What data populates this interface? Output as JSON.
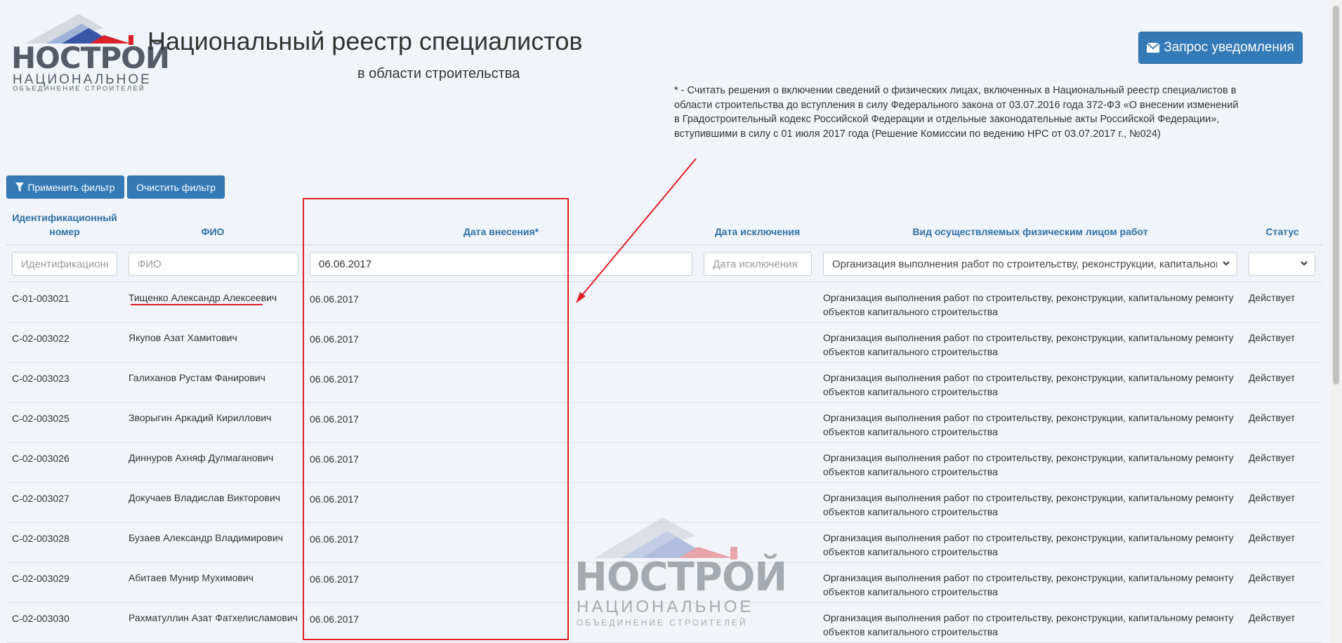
{
  "logo": {
    "word": "НОСТРОЙ",
    "line1": "НАЦИОНАЛЬНОЕ",
    "line2": "ОБЪЕДИНЕНИЕ СТРОИТЕЛЕЙ"
  },
  "header": {
    "title": "Национальный реестр специалистов",
    "subtitle": "в области строительства",
    "notify_button": "Запрос уведомления",
    "notice": "* - Считать решения о включении сведений о физических лицах, включенных в Национальный реестр специалистов в области строительства до вступления в силу Федерального закона от 03.07.2016 года 372-ФЗ «О внесении изменений в Градостроительный кодекс Российской Федерации и отдельные законодательные акты Российской Федерации», вступившими в силу с 01 июля 2017 года (Решение Комиссии по ведению НРС от 03.07.2017 г., №024)"
  },
  "toolbar": {
    "apply_label": "Применить фильтр",
    "clear_label": "Очистить фильтр"
  },
  "table": {
    "headers": {
      "id_line1": "Идентификационный",
      "id_line2": "номер",
      "name": "ФИО",
      "date_added": "Дата внесения*",
      "date_excluded": "Дата исключения",
      "work_type": "Вид осуществляемых физическим лицом работ",
      "status": "Статус"
    },
    "filters": {
      "id_placeholder": "Идентификационный номер",
      "name_placeholder": "ФИО",
      "date_added_value": "06.06.2017",
      "date_excluded_placeholder": "Дата исключения",
      "work_type_selected": "Организация выполнения работ по строительству, реконструкции, капитальному ремонту объектов капитального строительства",
      "status_selected": ""
    },
    "rows": [
      {
        "id": "С-01-003021",
        "name": "Тищенко Александр Алексеевич",
        "date": "06.06.2017",
        "work": "Организация выполнения работ по строительству, реконструкции, капитальному ремонту объектов капитального строительства",
        "status": "Действует"
      },
      {
        "id": "С-02-003022",
        "name": "Якупов Азат Хамитович",
        "date": "06.06.2017",
        "work": "Организация выполнения работ по строительству, реконструкции, капитальному ремонту объектов капитального строительства",
        "status": "Действует"
      },
      {
        "id": "С-02-003023",
        "name": "Галиханов Рустам Фанирович",
        "date": "06.06.2017",
        "work": "Организация выполнения работ по строительству, реконструкции, капитальному ремонту объектов капитального строительства",
        "status": "Действует"
      },
      {
        "id": "С-02-003025",
        "name": "Зворыгин Аркадий Кириллович",
        "date": "06.06.2017",
        "work": "Организация выполнения работ по строительству, реконструкции, капитальному ремонту объектов капитального строительства",
        "status": "Действует"
      },
      {
        "id": "С-02-003026",
        "name": "Диннуров Ахняф Дулмаганович",
        "date": "06.06.2017",
        "work": "Организация выполнения работ по строительству, реконструкции, капитальному ремонту объектов капитального строительства",
        "status": "Действует"
      },
      {
        "id": "С-02-003027",
        "name": "Докучаев Владислав Викторович",
        "date": "06.06.2017",
        "work": "Организация выполнения работ по строительству, реконструкции, капитальному ремонту объектов капитального строительства",
        "status": "Действует"
      },
      {
        "id": "С-02-003028",
        "name": "Бузаев Александр Владимирович",
        "date": "06.06.2017",
        "work": "Организация выполнения работ по строительству, реконструкции, капитальному ремонту объектов капитального строительства",
        "status": "Действует"
      },
      {
        "id": "С-02-003029",
        "name": "Абитаев Мунир Мухимович",
        "date": "06.06.2017",
        "work": "Организация выполнения работ по строительству, реконструкции, капитальному ремонту объектов капитального строительства",
        "status": "Действует"
      },
      {
        "id": "С-02-003030",
        "name": "Рахматуллин Азат Фатхелисламович",
        "date": "06.06.2017",
        "work": "Организация выполнения работ по строительству, реконструкции, капитальному ремонту объектов капитального строительства",
        "status": "Действует"
      }
    ]
  },
  "watermark": {
    "word": "НОСТРОЙ",
    "line1": "НАЦИОНАЛЬНОЕ",
    "line2": "ОБЪЕДИНЕНИЕ СТРОИТЕЛЕЙ"
  },
  "colors": {
    "accent": "#337ab7",
    "header_text": "#2f6fa7",
    "annotation_red": "#e01f26",
    "background": "#f1f5fb"
  }
}
